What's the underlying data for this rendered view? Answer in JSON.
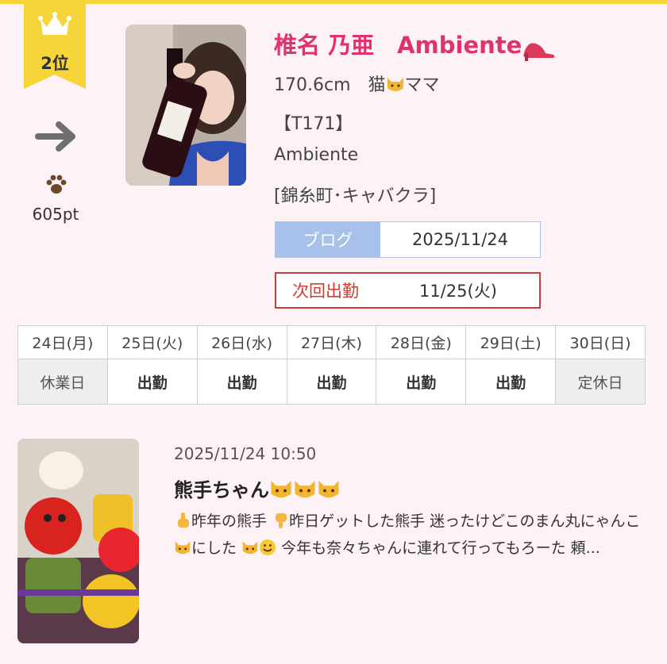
{
  "rank": {
    "label": "2位",
    "points": "605pt",
    "trend": "flat"
  },
  "cast": {
    "name": "椎名 乃亜　Ambiente",
    "height_pet_prefix": "170.6cm　猫",
    "height_pet_suffix": "ママ",
    "tag": "【T171】",
    "shop": "Ambiente",
    "area_genre": "[錦糸町･キャバクラ]"
  },
  "blog": {
    "label": "ブログ",
    "date": "2025/11/24"
  },
  "next_shift": {
    "label": "次回出勤",
    "date": "11/25(火)"
  },
  "schedule": {
    "days": [
      {
        "day": "24日(月)",
        "status": "休業日"
      },
      {
        "day": "25日(火)",
        "status": "出勤"
      },
      {
        "day": "26日(水)",
        "status": "出勤"
      },
      {
        "day": "27日(木)",
        "status": "出勤"
      },
      {
        "day": "28日(金)",
        "status": "出勤"
      },
      {
        "day": "29日(土)",
        "status": "出勤"
      },
      {
        "day": "30日(日)",
        "status": "定休日"
      }
    ]
  },
  "post": {
    "datetime": "2025/11/24 10:50",
    "title": "熊手ちゃん",
    "excerpt_1": "昨年の熊手",
    "excerpt_2": "昨日ゲットした熊手 迷ったけどこのまん丸にゃんこ",
    "excerpt_3": "にした",
    "excerpt_4": " 今年も奈々ちゃんに連れて行ってもろーた 頼..."
  },
  "colors": {
    "accent_pink": "#e0336e",
    "ribbon_yellow": "#f5d53a",
    "blog_blue": "#a7c1ea",
    "next_red": "#c44038",
    "weekend_pink": "#e0609f",
    "saturday_teal": "#3bb8b0",
    "page_bg": "#fdf2f6"
  },
  "icons": [
    "crown-icon",
    "right-arrow-icon",
    "paw-icon",
    "cat-emoji-icon",
    "high-heel-icon",
    "pointing-up-icon",
    "pointing-down-icon",
    "smile-emoji-icon"
  ]
}
